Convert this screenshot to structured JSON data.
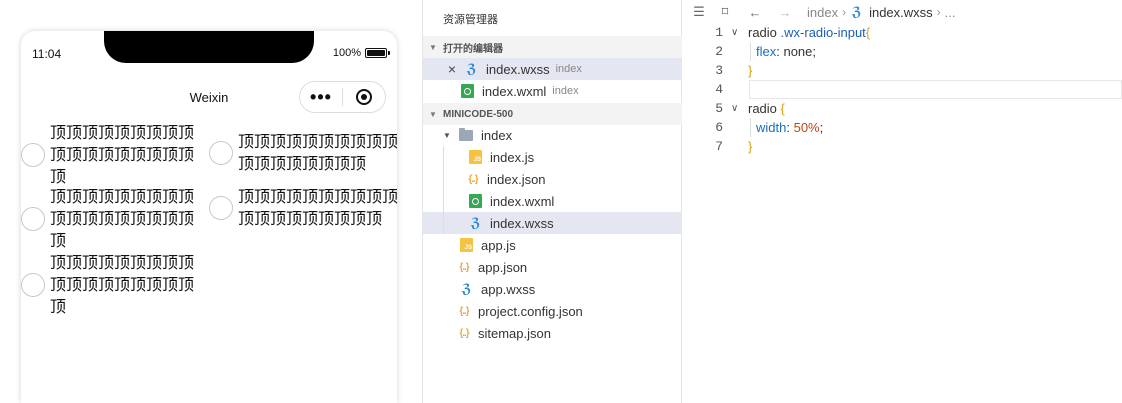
{
  "simulator": {
    "status_time": "11:04",
    "battery_percent": "100%",
    "nav_title": "Weixin",
    "capsule_more": "•••",
    "radios": [
      {
        "label": "顶顶顶顶顶顶顶顶顶顶顶顶顶顶顶顶顶顶顶"
      },
      {
        "label": "顶顶顶顶顶顶顶顶顶顶顶顶顶顶顶顶顶顶"
      },
      {
        "label": "顶顶顶顶顶顶顶顶顶顶顶顶顶顶顶顶顶顶顶"
      },
      {
        "label": "顶顶顶顶顶顶顶顶顶顶顶顶顶顶顶顶顶顶顶"
      },
      {
        "label": "顶顶顶顶顶顶顶顶顶顶顶顶顶顶顶顶顶顶顶"
      }
    ]
  },
  "explorer": {
    "title": "资源管理器",
    "open_editors_header": "打开的编辑器",
    "open_editors": [
      {
        "name": "index.wxss",
        "desc": "index",
        "type": "wxss"
      },
      {
        "name": "index.wxml",
        "desc": "index",
        "type": "wxml"
      }
    ],
    "project_header": "MINICODE-500",
    "folder": "index",
    "folder_files": [
      {
        "name": "index.js",
        "type": "js"
      },
      {
        "name": "index.json",
        "type": "json"
      },
      {
        "name": "index.wxml",
        "type": "wxml"
      },
      {
        "name": "index.wxss",
        "type": "wxss"
      }
    ],
    "root_files": [
      {
        "name": "app.js",
        "type": "js"
      },
      {
        "name": "app.json",
        "type": "json"
      },
      {
        "name": "app.wxss",
        "type": "wxss"
      },
      {
        "name": "project.config.json",
        "type": "json"
      },
      {
        "name": "sitemap.json",
        "type": "json"
      }
    ]
  },
  "editor": {
    "breadcrumb": {
      "folder": "index",
      "file": "index.wxss",
      "more": "..."
    },
    "lines": [
      {
        "no": "1",
        "selector": "radio",
        "cls": " .wx-radio-input",
        "brace": "{"
      },
      {
        "no": "2",
        "prop": "flex",
        "value": " none",
        "num": ""
      },
      {
        "no": "3",
        "brace": "}"
      },
      {
        "no": "4"
      },
      {
        "no": "5",
        "selector": "radio",
        "cls": "",
        "brace": " {"
      },
      {
        "no": "6",
        "prop": "width",
        "value": "",
        "num": " 50%"
      },
      {
        "no": "7",
        "brace": "}"
      }
    ],
    "css_icon": "ℨ",
    "colors": {
      "selection": "#e4e6f1",
      "brace": "#d4a017",
      "property": "#1a6fc4",
      "number": "#b5471a"
    }
  }
}
